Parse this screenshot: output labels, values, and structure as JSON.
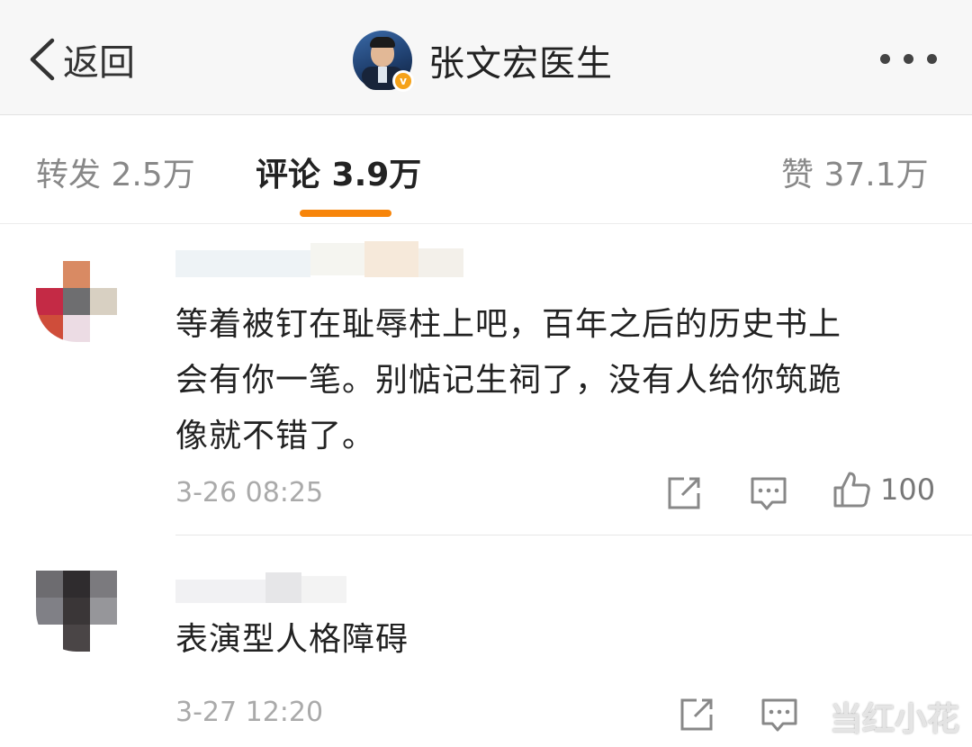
{
  "header": {
    "back_label": "返回",
    "title": "张文宏医生",
    "verified_badge": "v",
    "back_icon": "chevron-left-icon",
    "more_icon": "more-dots-icon"
  },
  "tabs": [
    {
      "label": "转发 2.5万",
      "active": false
    },
    {
      "label": "评论 3.9万",
      "active": true
    },
    {
      "label": "赞 37.1万",
      "active": false
    }
  ],
  "colors": {
    "accent": "#f7850a",
    "verified": "#f5a21a",
    "muted_text": "#aaaaaa"
  },
  "comments": [
    {
      "text_lines": [
        "等着被钉在耻辱柱上吧，百年之后的历史书上",
        "会有你一笔。别惦记生祠了，没有人给你筑跪",
        "像就不错了。"
      ],
      "time": "3-26 08:25",
      "likes": "100"
    },
    {
      "text_lines": [
        "表演型人格障碍"
      ],
      "time": "3-27 12:20",
      "likes": ""
    }
  ],
  "watermark": "当红小花"
}
